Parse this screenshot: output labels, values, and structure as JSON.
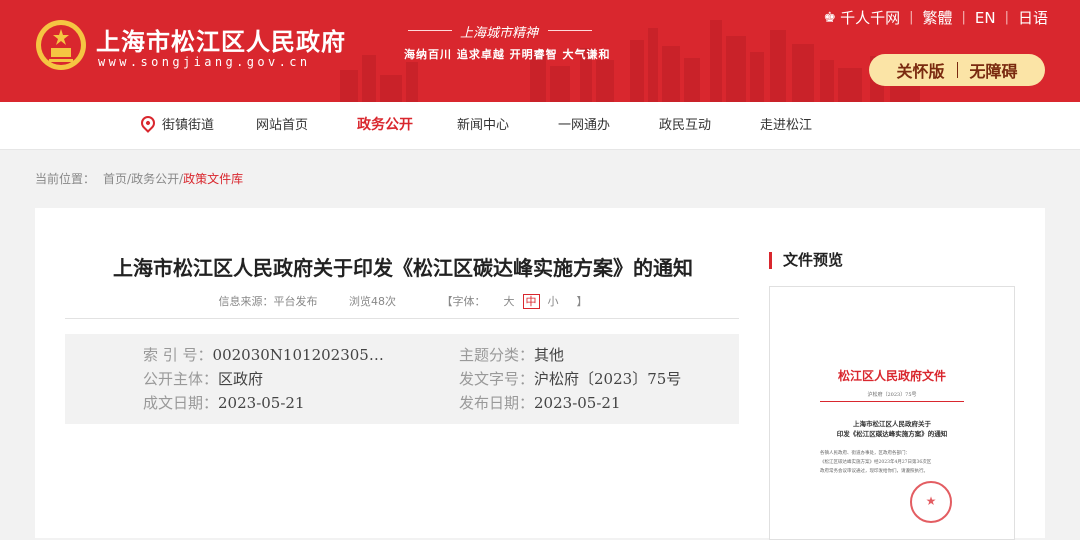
{
  "header": {
    "site_title": "上海市松江区人民政府",
    "site_url": "www.songjiang.gov.cn",
    "slogan_title": "上海城市精神",
    "slogan_sub": "海纳百川 追求卓越 开明睿智 大气谦和",
    "toplinks": [
      "千人千网",
      "繁體",
      "EN",
      "日语"
    ],
    "care_mode": "关怀版",
    "barrier_free": "无障碍",
    "brand_color": "#d9272e"
  },
  "nav": {
    "location": "街镇街道",
    "items": [
      "网站首页",
      "政务公开",
      "新闻中心",
      "一网通办",
      "政民互动",
      "走进松江"
    ],
    "active": "政务公开"
  },
  "breadcrumb": {
    "label": "当前位置：",
    "home": "首页",
    "level1": "政务公开",
    "current": "政策文件库"
  },
  "article": {
    "title": "上海市松江区人民政府关于印发《松江区碳达峰实施方案》的通知",
    "source": "信息来源：平台发布",
    "views": "浏览48次",
    "font_label": "【字体：",
    "font_sizes": [
      "大",
      "中",
      "小"
    ],
    "font_end": "】",
    "info": {
      "index_label": "索 引 号：",
      "index_value": "002030N101202305…",
      "category_label": "主题分类：",
      "category_value": "其他",
      "publisher_label": "公开主体：",
      "publisher_value": "区政府",
      "docno_label": "发文字号：",
      "docno_value": "沪松府〔2023〕75号",
      "created_label": "成文日期：",
      "created_value": "2023-05-21",
      "published_label": "发布日期：",
      "published_value": "2023-05-21"
    }
  },
  "preview": {
    "heading": "文件预览",
    "doc_header": "松江区人民政府文件",
    "doc_number": "沪松府〔2023〕75号",
    "doc_title_1": "上海市松江区人民政府关于",
    "doc_title_2": "印发《松江区碳达峰实施方案》的通知",
    "body_1": "各镇人民政府、街道办事处，区政府各部门：",
    "body_2": "《松江区碳达峰实施方案》经2023年4月27日第36次区",
    "body_3": "政府常务会议审议通过，现印发给你们，请遵照执行。"
  }
}
